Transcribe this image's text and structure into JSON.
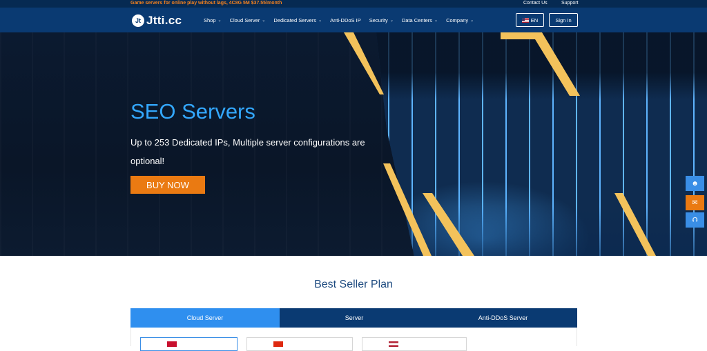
{
  "topbar": {
    "promo": "Game servers for online play without lags, 4C8G 5M $37.55/month",
    "contact": "Contact Us",
    "support": "Support"
  },
  "nav": {
    "logo_mark": "Jt",
    "logo_text": "Jtti.cc",
    "items": [
      "Shop",
      "Cloud Server",
      "Dedicated Servers",
      "Anti-DDoS IP",
      "Security",
      "Data Centers",
      "Company"
    ],
    "lang": "EN",
    "signin": "Sign In"
  },
  "hero": {
    "title": "SEO Servers",
    "subtitle": "Up to 253 Dedicated IPs,  Multiple server configurations are optional!",
    "cta": "BUY NOW"
  },
  "section": {
    "title": "Best Seller Plan",
    "tabs": [
      "Cloud Server",
      "Server",
      "Anti-DDoS Server"
    ],
    "active_tab": "Cloud Server"
  },
  "colors": {
    "nav_bg": "#0a3a72",
    "accent_blue": "#33a8ff",
    "cta_orange": "#ea7a12",
    "stripe_yellow": "#f3c25b",
    "tab_active": "#2f8fef"
  },
  "icons": [
    "support-agent-icon",
    "chat-icon",
    "back-to-top-icon",
    "chevron-down-icon",
    "us-flag-icon"
  ]
}
